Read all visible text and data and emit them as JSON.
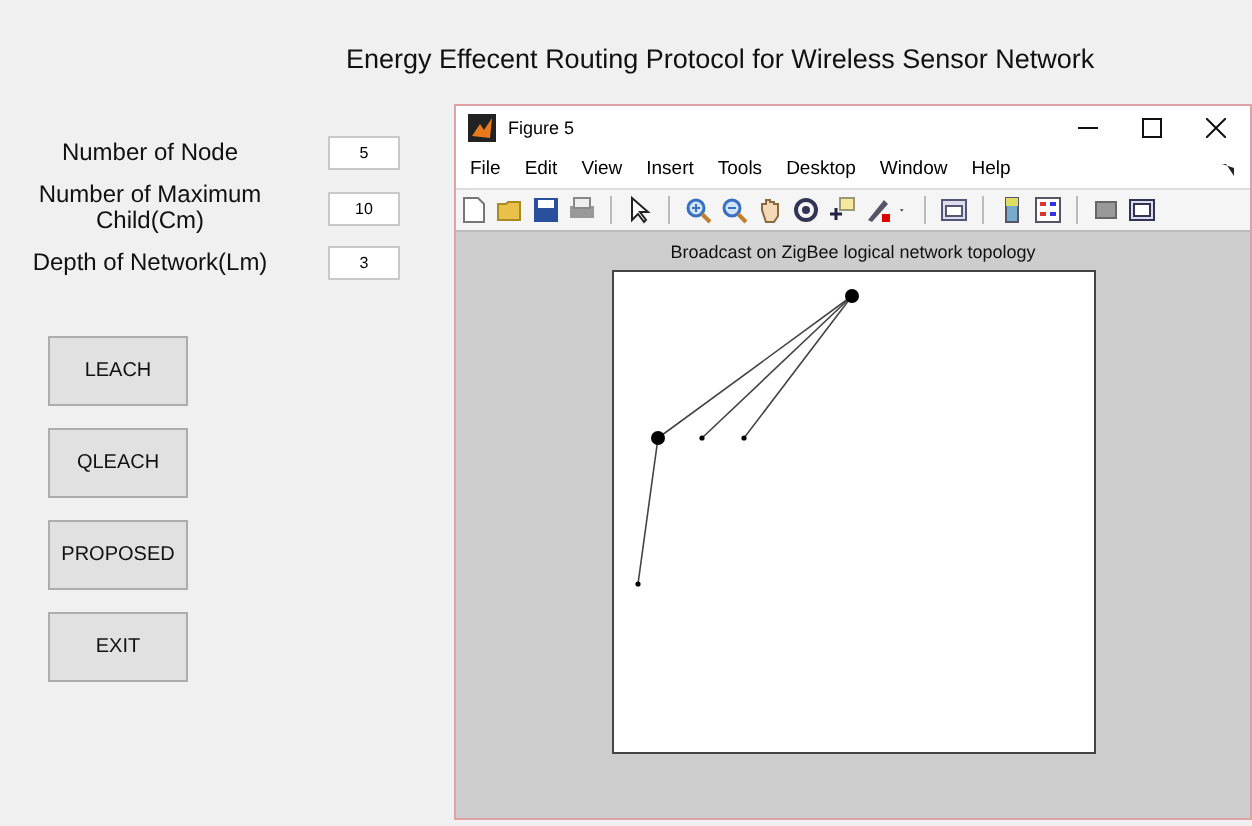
{
  "window": {
    "title": "Energy Effecent Routing Protocol for Wireless Sensor Network"
  },
  "fields": [
    {
      "label": "Number of Node",
      "value": "5"
    },
    {
      "label": "Number of Maximum Child(Cm)",
      "value": "10"
    },
    {
      "label": "Depth of Network(Lm)",
      "value": "3"
    }
  ],
  "buttons": [
    "LEACH",
    "QLEACH",
    "PROPOSED",
    "EXIT"
  ],
  "figure": {
    "title": "Figure 5",
    "menu": [
      "File",
      "Edit",
      "View",
      "Insert",
      "Tools",
      "Desktop",
      "Window",
      "Help"
    ],
    "plot_title": "Broadcast on ZigBee logical network topology"
  }
}
